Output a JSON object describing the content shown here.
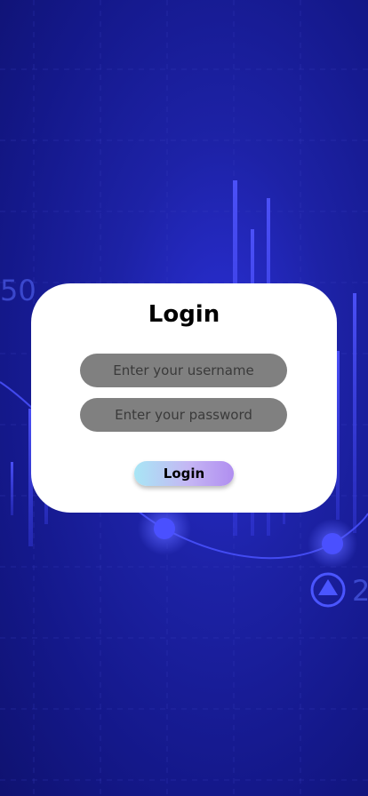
{
  "background": {
    "number_left": "50",
    "number_right": "2",
    "colors": {
      "base": "#14188a",
      "glow": "#2a2fd6",
      "bars": "#4a4dff",
      "curve": "#4a52ff"
    }
  },
  "login_card": {
    "title": "Login",
    "username_placeholder": "Enter your username",
    "password_placeholder": "Enter your password",
    "submit_label": "Login"
  }
}
